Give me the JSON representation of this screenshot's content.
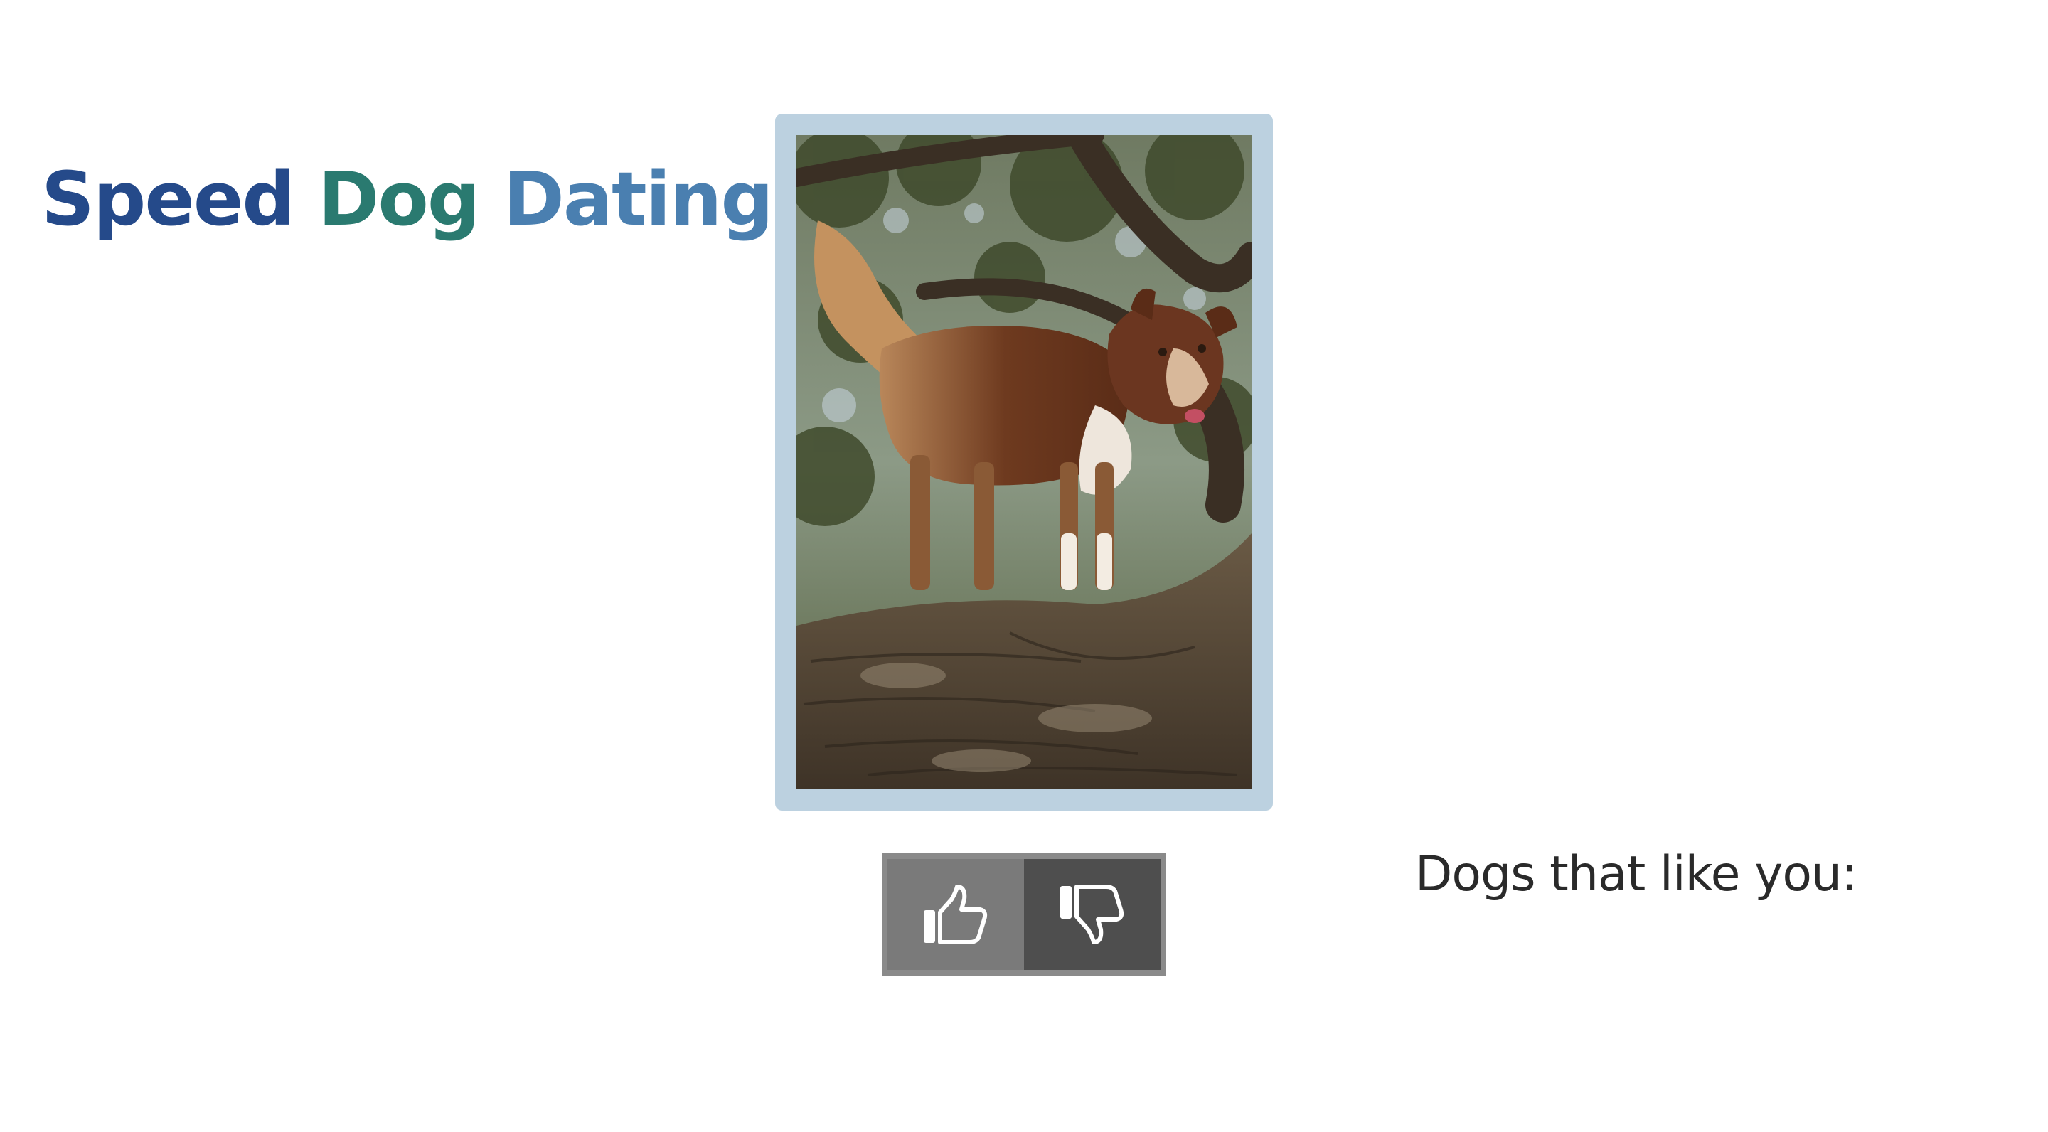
{
  "header": {
    "title_parts": [
      {
        "text": "Speed",
        "color": "#254a8a"
      },
      {
        "text": "Dog",
        "color": "#2a7a70"
      },
      {
        "text": "Dating",
        "color": "#4a7fb0"
      }
    ]
  },
  "profile": {
    "frame_color": "#bcd1e0"
  },
  "actions": {
    "like_icon": "thumbs-up-icon",
    "dislike_icon": "thumbs-down-icon"
  },
  "likes": {
    "heading": "Dogs that like you:",
    "items": []
  }
}
